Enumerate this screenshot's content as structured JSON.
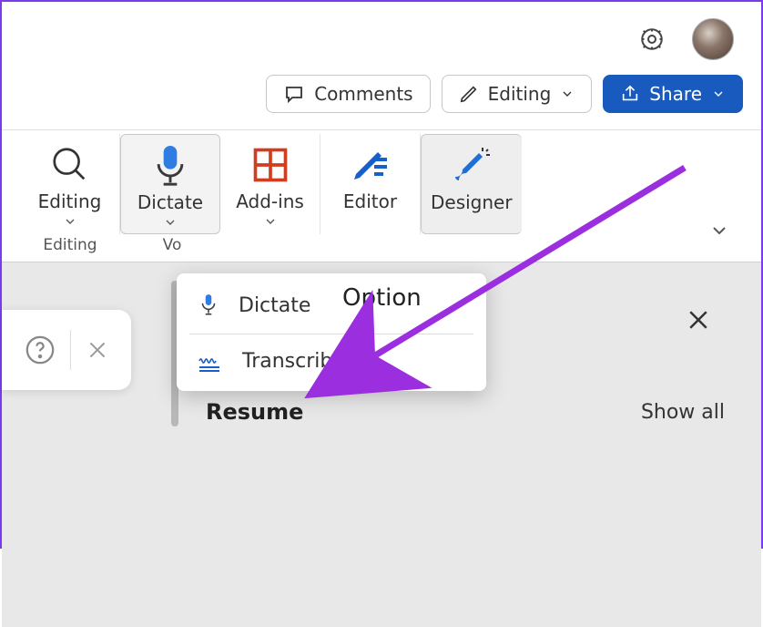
{
  "header": {
    "settings_icon": "gear-icon",
    "avatar": "user-avatar"
  },
  "actions": {
    "comments": "Comments",
    "editing": "Editing",
    "share": "Share"
  },
  "ribbon": {
    "items": [
      {
        "label": "Editing",
        "name": "editing-button"
      },
      {
        "label": "Dictate",
        "name": "dictate-button"
      },
      {
        "label": "Add-ins",
        "name": "addins-button"
      },
      {
        "label": "Editor",
        "name": "editor-button"
      },
      {
        "label": "Designer",
        "name": "designer-button"
      }
    ],
    "group_labels": {
      "editing": "Editing",
      "voice": "Vo"
    }
  },
  "dictate_menu": {
    "dictate": "Dictate",
    "transcribe": "Transcribe",
    "option_caption": "Option"
  },
  "panel": {
    "title": "Resume",
    "show_all": "Show all"
  },
  "colors": {
    "accent_blue": "#185abd",
    "annotation": "#9b2fe0"
  }
}
